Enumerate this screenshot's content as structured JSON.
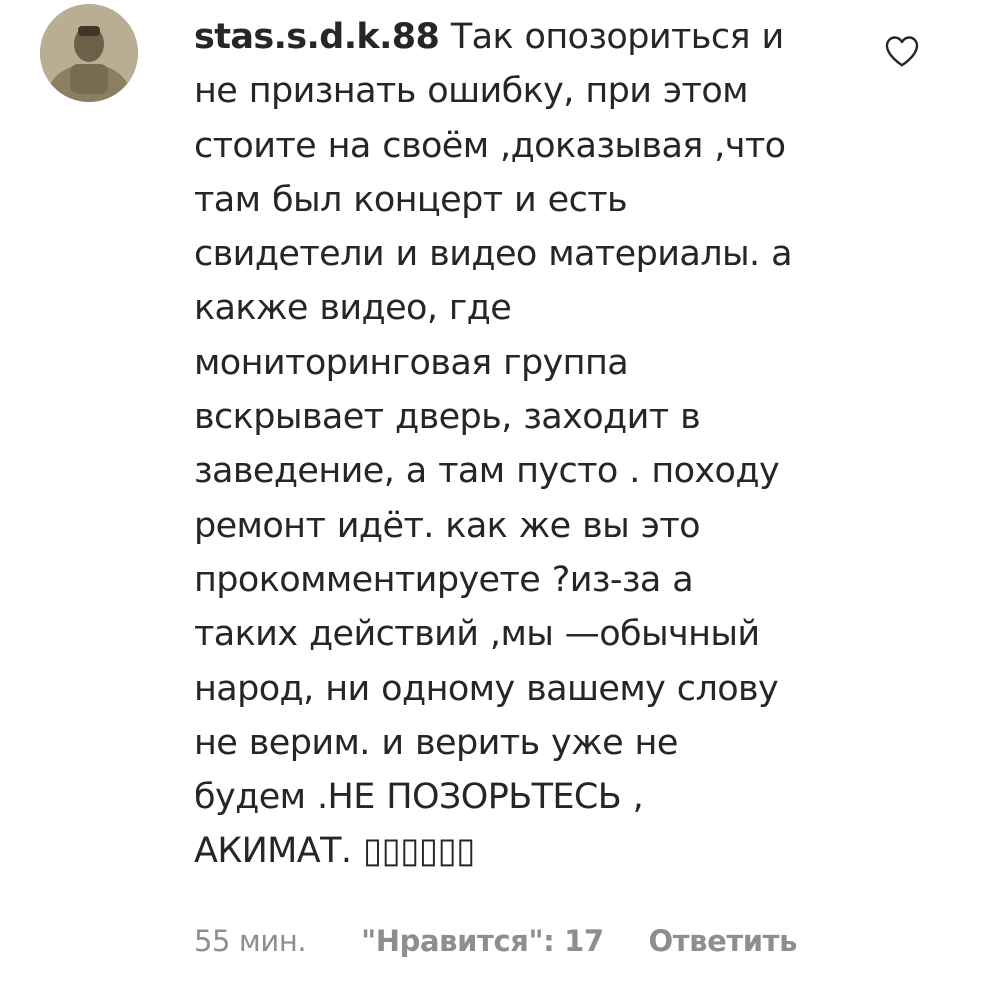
{
  "comment": {
    "username": "stas.s.d.k.88",
    "text_lines": [
      "Так опозориться и",
      "не признать ошибку, при этом",
      "стоите на своём ,доказывая ,что",
      "там был концерт и есть",
      "свидетели и видео материалы. а",
      "какже видео, где",
      "мониторинговая группа",
      "вскрывает дверь, заходит в",
      "заведение, а там пусто . походу",
      "ремонт идёт. как же вы это",
      "прокомментируете ?из-за а",
      "таких действий ,мы —обычный",
      "народ, ни одному вашему слову",
      "не верим. и верить уже не",
      "будем .НЕ ПОЗОРЬТЕСЬ ,",
      "АКИМАТ. ▯▯▯▯▯▯"
    ],
    "time": "55 мин.",
    "likes": "\"Нравится\": 17",
    "reply_label": "Ответить",
    "avatar_icon": "user-avatar",
    "like_icon": "heart-outline-icon"
  },
  "colors": {
    "text": "#262626",
    "meta": "#8e8e8e",
    "background": "#ffffff"
  }
}
